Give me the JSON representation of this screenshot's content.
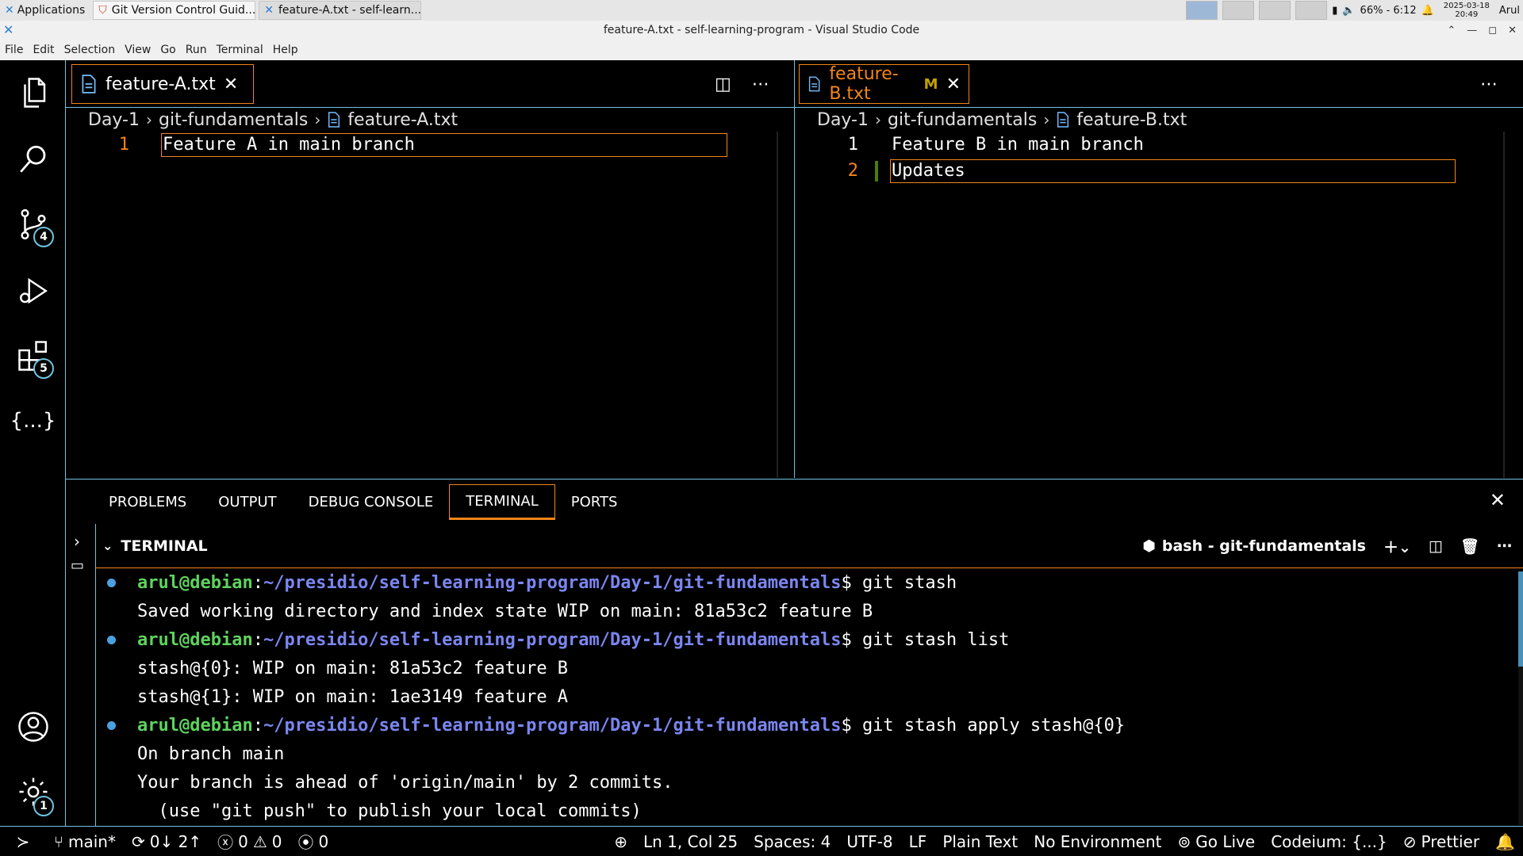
{
  "os": {
    "app_menu": "Applications",
    "tasks": [
      {
        "title": "Git Version Control Guid..."
      },
      {
        "title": "feature-A.txt - self-learn..."
      }
    ],
    "battery": "66% - 6:12",
    "date": "2025-03-18",
    "time": "20:49",
    "user": "Arul"
  },
  "window": {
    "title": "feature-A.txt - self-learning-program - Visual Studio Code"
  },
  "menu": [
    "File",
    "Edit",
    "Selection",
    "View",
    "Go",
    "Run",
    "Terminal",
    "Help"
  ],
  "activity_badges": {
    "scm": "4",
    "extensions": "5",
    "settings": "1"
  },
  "activity_icons": [
    "files-icon",
    "search-icon",
    "source-control-icon",
    "run-debug-icon",
    "extensions-icon",
    "json-braces-icon",
    "account-icon",
    "gear-icon"
  ],
  "editorA": {
    "tab_label": "feature-A.txt",
    "breadcrumb": [
      "Day-1",
      "git-fundamentals",
      "feature-A.txt"
    ],
    "lines": [
      {
        "num": "1",
        "text": "Feature A in main branch"
      }
    ]
  },
  "editorB": {
    "tab_label": "feature-B.txt",
    "tab_status": "M",
    "breadcrumb": [
      "Day-1",
      "git-fundamentals",
      "feature-B.txt"
    ],
    "lines": [
      {
        "num": "1",
        "text": "Feature B in main branch"
      },
      {
        "num": "2",
        "text": "Updates"
      }
    ]
  },
  "panel": {
    "tabs": [
      "PROBLEMS",
      "OUTPUT",
      "DEBUG CONSOLE",
      "TERMINAL",
      "PORTS"
    ],
    "active_tab": "TERMINAL",
    "terminal_title": "TERMINAL",
    "shell_label": "bash - git-fundamentals"
  },
  "terminal": {
    "prompt_user": "arul@debian",
    "prompt_path": "~/presidio/self-learning-program/Day-1/git-fundamentals",
    "cmd1": "git stash",
    "out1": "Saved working directory and index state WIP on main: 81a53c2 feature B",
    "cmd2": "git stash list",
    "out2a": "stash@{0}: WIP on main: 81a53c2 feature B",
    "out2b": "stash@{1}: WIP on main: 1ae3149 feature A",
    "cmd3": "git stash apply stash@{0}",
    "out3a": "On branch main",
    "out3b": "Your branch is ahead of 'origin/main' by 2 commits.",
    "out3c": "  (use \"git push\" to publish your local commits)"
  },
  "statusbar": {
    "branch": "main*",
    "sync": "0↓ 2↑",
    "errors": "0",
    "warnings": "0",
    "ports": "0",
    "position": "Ln 1, Col 25",
    "spaces": "Spaces: 4",
    "encoding": "UTF-8",
    "eol": "LF",
    "language": "Plain Text",
    "environment": "No Environment",
    "golive": "Go Live",
    "codeium": "Codeium: {...}",
    "prettier": "Prettier"
  },
  "colors": {
    "focus_border": "#f38518",
    "contrast_border": "#6fc3df",
    "prompt_user": "#5fd35f",
    "prompt_path": "#7b86f0"
  }
}
